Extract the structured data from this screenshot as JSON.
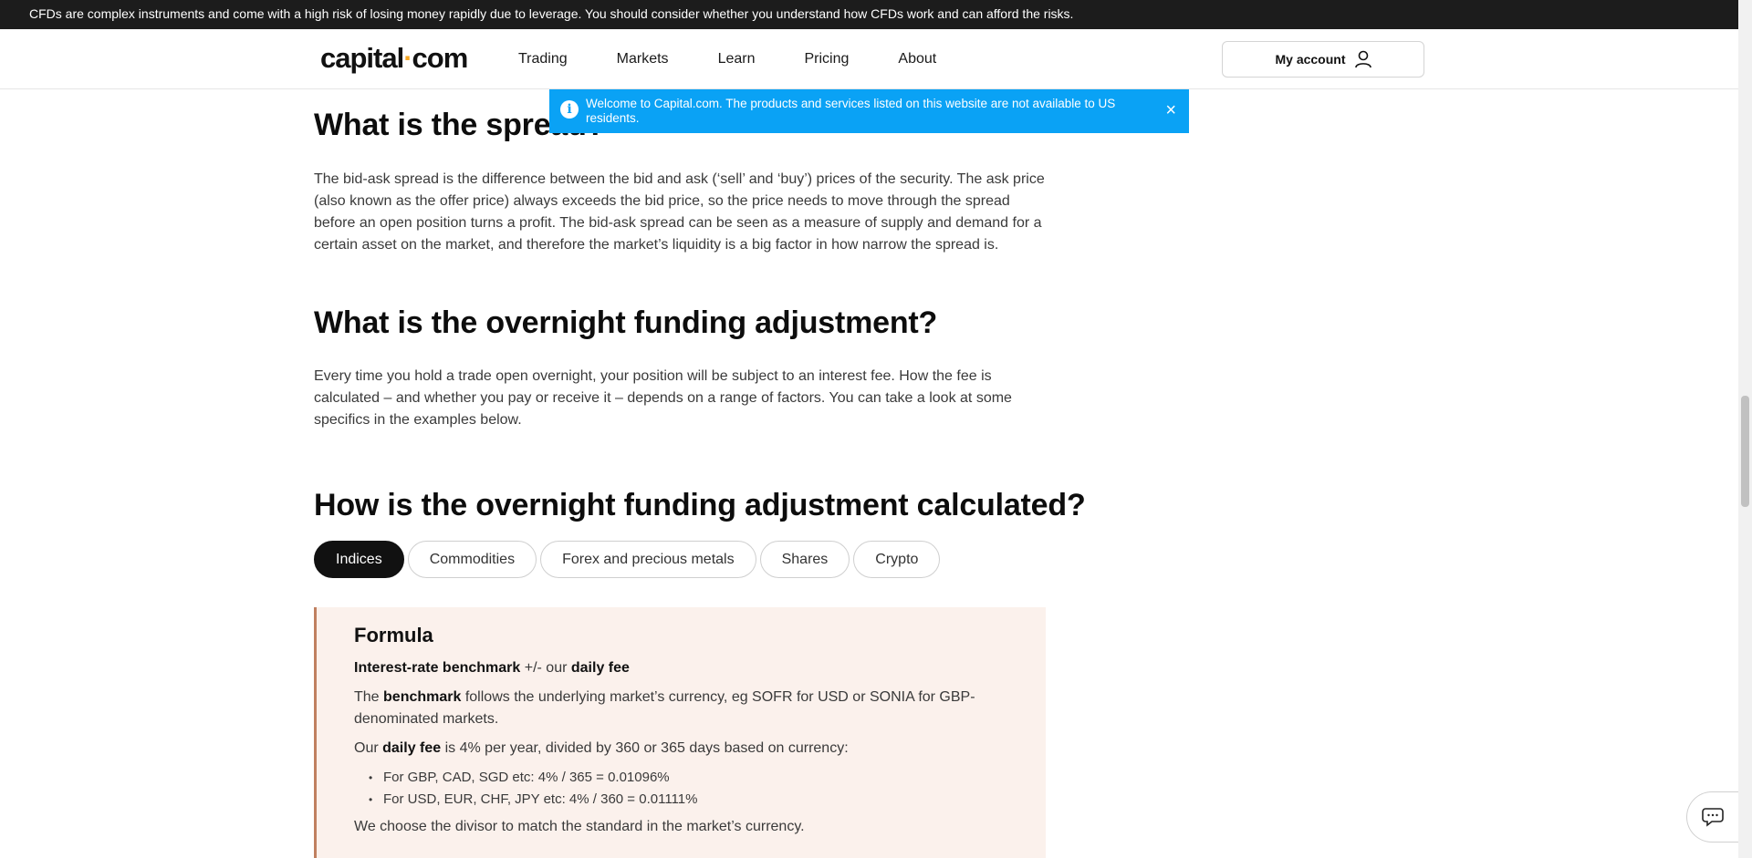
{
  "risk_warning": "CFDs are complex instruments and come with a high risk of losing money rapidly due to leverage. You should consider whether you understand how CFDs work and can afford the risks.",
  "header": {
    "logo_left": "capital",
    "logo_dot": "·",
    "logo_right": "com",
    "nav": [
      "Trading",
      "Markets",
      "Learn",
      "Pricing",
      "About"
    ],
    "account_label": "My account"
  },
  "notice": {
    "info_glyph": "i",
    "text": "Welcome to Capital.com. The products and services listed on this website are not available to US residents.",
    "close_glyph": "×"
  },
  "sections": {
    "spread_title": "What is the spread?",
    "spread_body": "The bid-ask spread is the difference between the bid and ask (‘sell’ and ‘buy’) prices of the security. The ask price (also known as the offer price) always exceeds the bid price, so the price needs to move through the spread before an open position turns a profit. The bid-ask spread can be seen as a measure of supply and demand for a certain asset on the market, and therefore the market’s liquidity is a big factor in how narrow the spread is.",
    "overnight_title": "What is the overnight funding adjustment?",
    "overnight_body": "Every time you hold a trade open overnight, your position will be subject to an interest fee. How the fee is calculated – and whether you pay or receive it – depends on a range of factors. You can take a look at some specifics in the examples below.",
    "calc_title": "How is the overnight funding adjustment calculated?"
  },
  "tabs": [
    "Indices",
    "Commodities",
    "Forex and precious metals",
    "Shares",
    "Crypto"
  ],
  "active_tab": "Indices",
  "formula": {
    "heading": "Formula",
    "line1_bold1": "Interest-rate benchmark",
    "line1_mid": " +/- our ",
    "line1_bold2": "daily fee",
    "line2_pre": "The ",
    "line2_bold": "benchmark",
    "line2_post": " follows the underlying market’s currency, eg SOFR for USD or SONIA for GBP-denominated markets.",
    "line3_pre": "Our ",
    "line3_bold": "daily fee",
    "line3_post": " is 4% per year, divided by 360 or 365 days based on currency:",
    "bullets": [
      "For GBP, CAD, SGD etc: 4% / 365 = 0.01096%",
      "For USD, EUR, CHF, JPY etc: 4% / 360 = 0.01111%"
    ],
    "line4": "We choose the divisor to match the standard in the market’s currency."
  }
}
